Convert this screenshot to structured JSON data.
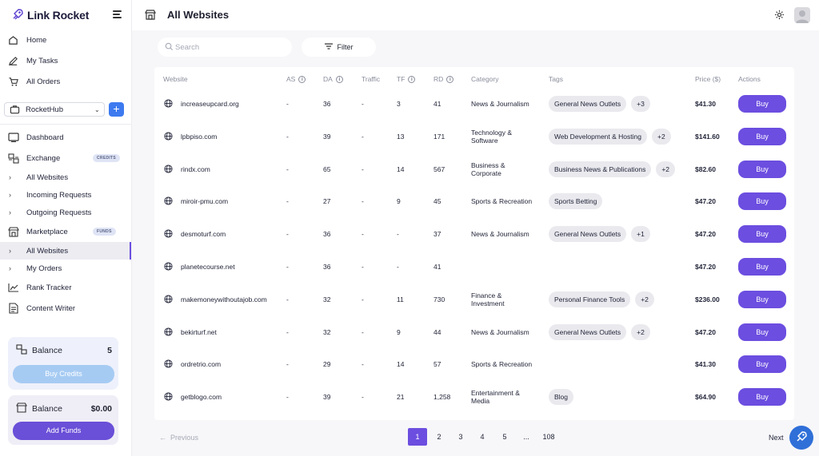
{
  "brand": {
    "name": "Link Rocket"
  },
  "sidebar": {
    "top_items": [
      {
        "label": "Home",
        "icon": "home-icon"
      },
      {
        "label": "My Tasks",
        "icon": "pencil-icon"
      },
      {
        "label": "All Orders",
        "icon": "cart-icon"
      }
    ],
    "workspace": {
      "label": "RocketHub",
      "add_label": "+"
    },
    "items": [
      {
        "label": "Dashboard",
        "icon": "dashboard-icon"
      },
      {
        "label": "Exchange",
        "icon": "exchange-icon",
        "badge": "CREDITS"
      },
      {
        "label": "All Websites"
      },
      {
        "label": "Incoming Requests"
      },
      {
        "label": "Outgoing Requests"
      },
      {
        "label": "Marketplace",
        "icon": "marketplace-icon",
        "badge": "FUNDS"
      },
      {
        "label": "All Websites"
      },
      {
        "label": "My Orders"
      },
      {
        "label": "Rank Tracker",
        "icon": "chart-icon"
      },
      {
        "label": "Content Writer",
        "icon": "document-icon"
      }
    ],
    "credits_card": {
      "title": "Balance",
      "value": "5",
      "button": "Buy Credits"
    },
    "funds_card": {
      "title": "Balance",
      "value": "$0.00",
      "button": "Add Funds"
    }
  },
  "header": {
    "title": "All Websites"
  },
  "toolbar": {
    "search_placeholder": "Search",
    "filter_label": "Filter"
  },
  "table": {
    "columns": [
      "Website",
      "AS",
      "DA",
      "Traffic",
      "TF",
      "RD",
      "Category",
      "Tags",
      "Price ($)",
      "Actions"
    ],
    "buy_label": "Buy",
    "rows": [
      {
        "site": "increaseupcard.org",
        "as": "-",
        "da": "36",
        "traffic": "-",
        "tf": "3",
        "rd": "41",
        "cat1": "News & Journalism",
        "cat2": "",
        "tag": "General News Outlets",
        "more": "+3",
        "price": "$41.30"
      },
      {
        "site": "lpbpiso.com",
        "as": "-",
        "da": "39",
        "traffic": "-",
        "tf": "13",
        "rd": "171",
        "cat1": "Technology &",
        "cat2": "Software",
        "tag": "Web Development & Hosting",
        "more": "+2",
        "price": "$141.60"
      },
      {
        "site": "rindx.com",
        "as": "-",
        "da": "65",
        "traffic": "-",
        "tf": "14",
        "rd": "567",
        "cat1": "Business &",
        "cat2": "Corporate",
        "tag": "Business News & Publications",
        "more": "+2",
        "price": "$82.60"
      },
      {
        "site": "miroir-pmu.com",
        "as": "-",
        "da": "27",
        "traffic": "-",
        "tf": "9",
        "rd": "45",
        "cat1": "Sports & Recreation",
        "cat2": "",
        "tag": "Sports Betting",
        "more": "",
        "price": "$47.20"
      },
      {
        "site": "desmoturf.com",
        "as": "-",
        "da": "36",
        "traffic": "-",
        "tf": "-",
        "rd": "37",
        "cat1": "News & Journalism",
        "cat2": "",
        "tag": "General News Outlets",
        "more": "+1",
        "price": "$47.20"
      },
      {
        "site": "planetecourse.net",
        "as": "-",
        "da": "36",
        "traffic": "-",
        "tf": "-",
        "rd": "41",
        "cat1": "",
        "cat2": "",
        "tag": "",
        "more": "",
        "price": "$47.20"
      },
      {
        "site": "makemoneywithoutajob.com",
        "as": "-",
        "da": "32",
        "traffic": "-",
        "tf": "11",
        "rd": "730",
        "cat1": "Finance &",
        "cat2": "Investment",
        "tag": "Personal Finance Tools",
        "more": "+2",
        "price": "$236.00"
      },
      {
        "site": "bekirturf.net",
        "as": "-",
        "da": "32",
        "traffic": "-",
        "tf": "9",
        "rd": "44",
        "cat1": "News & Journalism",
        "cat2": "",
        "tag": "General News Outlets",
        "more": "+2",
        "price": "$47.20"
      },
      {
        "site": "ordretrio.com",
        "as": "-",
        "da": "29",
        "traffic": "-",
        "tf": "14",
        "rd": "57",
        "cat1": "Sports & Recreation",
        "cat2": "",
        "tag": "",
        "more": "",
        "price": "$41.30"
      },
      {
        "site": "getblogo.com",
        "as": "-",
        "da": "39",
        "traffic": "-",
        "tf": "21",
        "rd": "1,258",
        "cat1": "Entertainment &",
        "cat2": "Media",
        "tag": "Blog",
        "more": "",
        "price": "$64.90"
      }
    ]
  },
  "pagination": {
    "prev": "Previous",
    "next": "Next",
    "pages": [
      "1",
      "2",
      "3",
      "4",
      "5",
      "...",
      "108"
    ],
    "current": "1"
  },
  "colors": {
    "accent": "#6c4ee0",
    "blue": "#3d7af0",
    "fab": "#2f6fd8"
  }
}
